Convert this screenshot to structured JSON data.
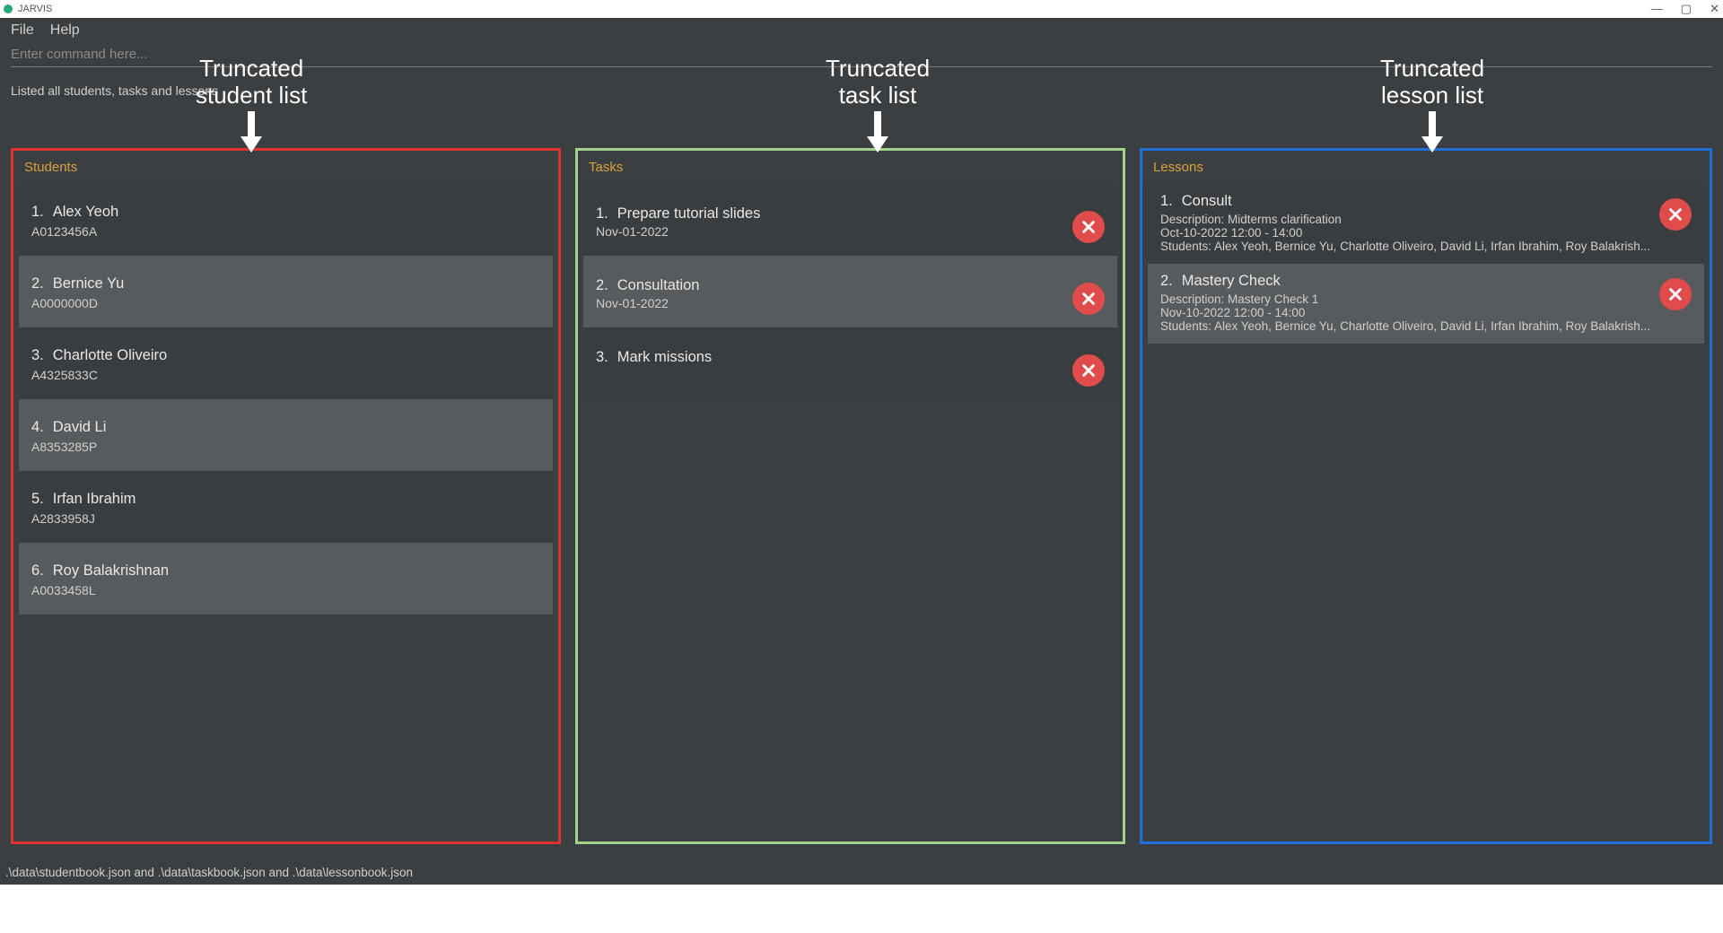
{
  "window": {
    "title": "JARVIS",
    "controls": {
      "minimize": "—",
      "maximize": "▢",
      "close": "✕"
    }
  },
  "menubar": {
    "file": "File",
    "help": "Help"
  },
  "command": {
    "placeholder": "Enter command here..."
  },
  "status": "Listed all students, tasks and lessons",
  "panels": {
    "students": {
      "header": "Students",
      "items": [
        {
          "idx": "1.",
          "name": "Alex Yeoh",
          "id": "A0123456A"
        },
        {
          "idx": "2.",
          "name": "Bernice Yu",
          "id": "A0000000D"
        },
        {
          "idx": "3.",
          "name": "Charlotte Oliveiro",
          "id": "A4325833C"
        },
        {
          "idx": "4.",
          "name": "David Li",
          "id": "A8353285P"
        },
        {
          "idx": "5.",
          "name": "Irfan Ibrahim",
          "id": "A2833958J"
        },
        {
          "idx": "6.",
          "name": "Roy Balakrishnan",
          "id": "A0033458L"
        }
      ]
    },
    "tasks": {
      "header": "Tasks",
      "items": [
        {
          "idx": "1.",
          "title": "Prepare tutorial slides",
          "date": "Nov-01-2022"
        },
        {
          "idx": "2.",
          "title": "Consultation",
          "date": "Nov-01-2022"
        },
        {
          "idx": "3.",
          "title": "Mark missions",
          "date": ""
        }
      ]
    },
    "lessons": {
      "header": "Lessons",
      "items": [
        {
          "idx": "1.",
          "title": "Consult",
          "desc": "Description: Midterms clarification",
          "time": "Oct-10-2022 12:00 - 14:00",
          "students": "Students: Alex Yeoh, Bernice Yu, Charlotte Oliveiro, David Li, Irfan Ibrahim, Roy Balakrish..."
        },
        {
          "idx": "2.",
          "title": "Mastery Check",
          "desc": "Description: Mastery Check 1",
          "time": "Nov-10-2022 12:00 - 14:00",
          "students": "Students: Alex Yeoh, Bernice Yu, Charlotte Oliveiro, David Li, Irfan Ibrahim, Roy Balakrish..."
        }
      ]
    }
  },
  "footer": ".\\data\\studentbook.json and .\\data\\taskbook.json and .\\data\\lessonbook.json",
  "annotations": {
    "students": "Truncated\nstudent list",
    "tasks": "Truncated\ntask list",
    "lessons": "Truncated\nlesson list"
  }
}
